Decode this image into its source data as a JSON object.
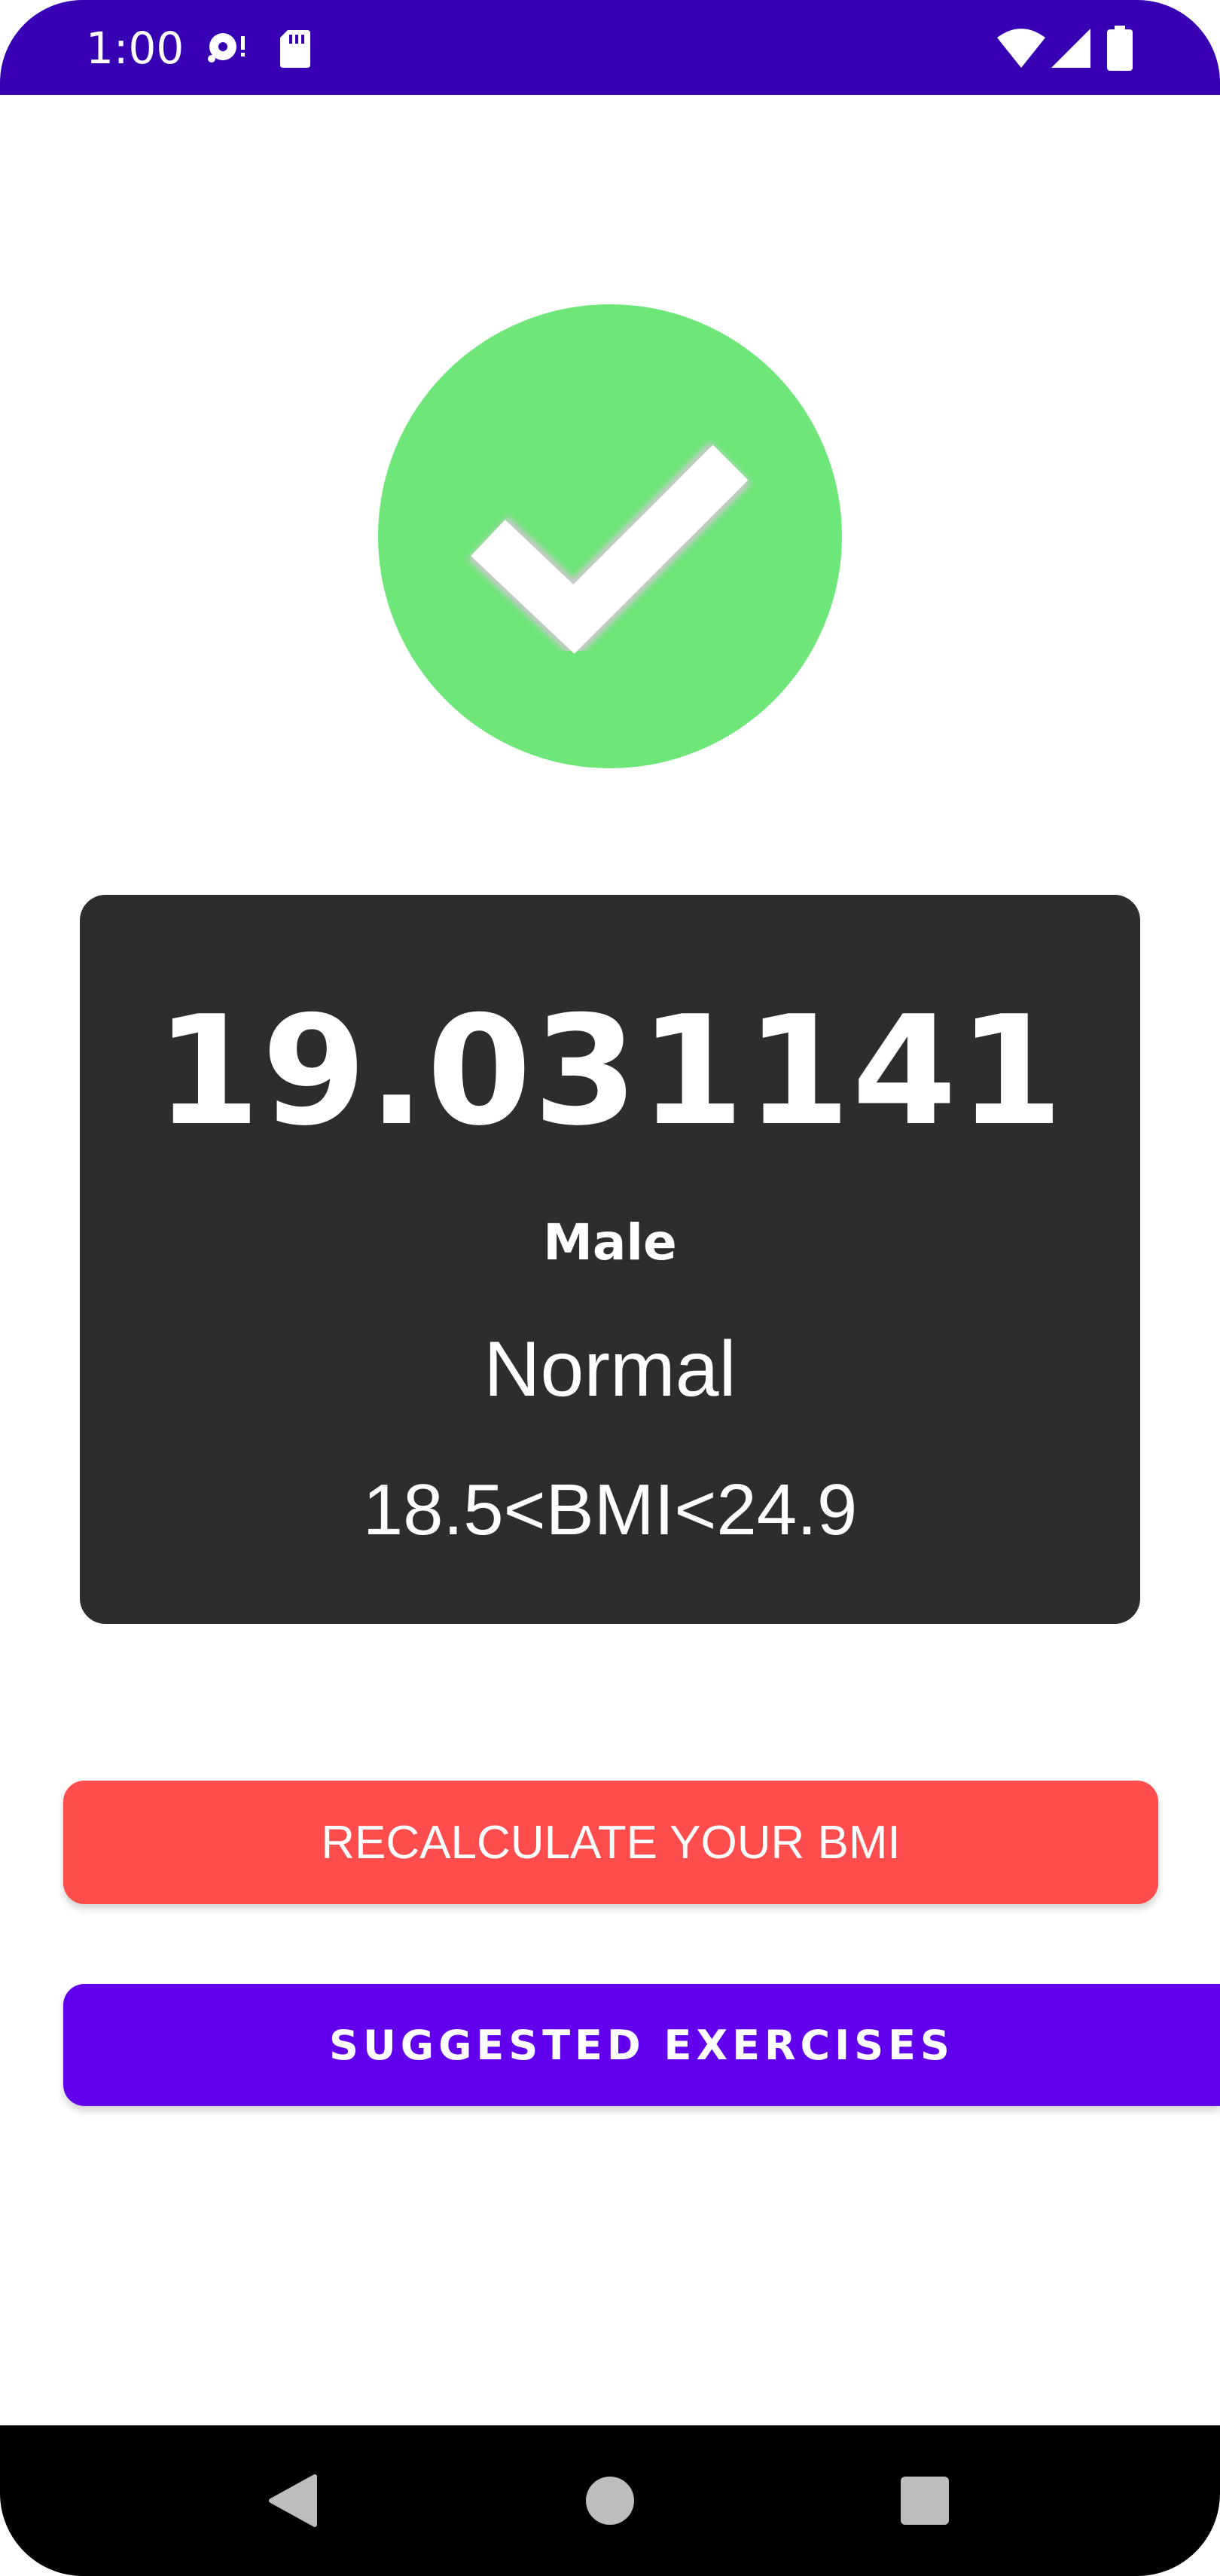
{
  "status_bar": {
    "time": "1:00",
    "icons": [
      "media-icon",
      "sd-card-icon",
      "wifi-icon",
      "signal-icon",
      "battery-icon"
    ],
    "background": "#3700b3"
  },
  "result": {
    "status_icon": "check-circle-icon",
    "icon_color": "#6ee67a",
    "bmi_value": "19.031141",
    "gender": "Male",
    "category": "Normal",
    "range": "18.5<BMI<24.9",
    "card_background": "#2d2d2d"
  },
  "actions": {
    "recalculate_label": "RECALCULATE YOUR BMI",
    "recalculate_color": "#ff4d4d",
    "exercises_label": "SUGGESTED EXERCISES",
    "exercises_color": "#6200ee"
  },
  "nav_bar": {
    "buttons": [
      "back-icon",
      "home-icon",
      "recents-icon"
    ]
  }
}
